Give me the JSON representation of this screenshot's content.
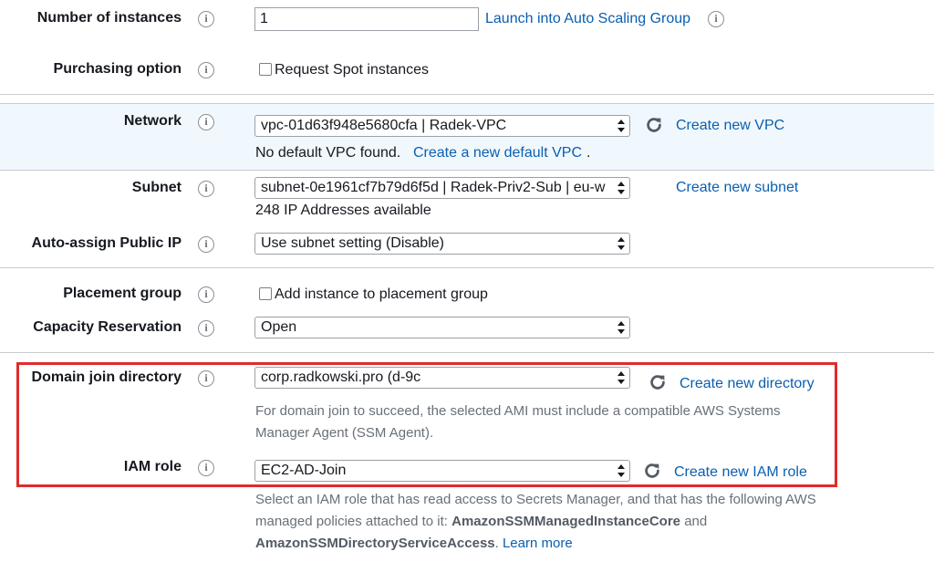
{
  "instances": {
    "label": "Number of instances",
    "value": "1",
    "asg_link": "Launch into Auto Scaling Group"
  },
  "purchasing": {
    "label": "Purchasing option",
    "checkbox_label": "Request Spot instances"
  },
  "network": {
    "label": "Network",
    "value": "vpc-01d63f948e5680cfa | Radek-VPC",
    "create_link": "Create new VPC",
    "no_default": "No default VPC found.",
    "create_default_link": "Create a new default VPC",
    "period": "."
  },
  "subnet": {
    "label": "Subnet",
    "value": "subnet-0e1961cf7b79d6f5d | Radek-Priv2-Sub | eu-w",
    "create_link": "Create new subnet",
    "available": "248 IP Addresses available"
  },
  "public_ip": {
    "label": "Auto-assign Public IP",
    "value": "Use subnet setting (Disable)"
  },
  "placement": {
    "label": "Placement group",
    "checkbox_label": "Add instance to placement group"
  },
  "capacity": {
    "label": "Capacity Reservation",
    "value": "Open"
  },
  "domain": {
    "label": "Domain join directory",
    "value": "corp.radkowski.pro (d-9c",
    "create_link": "Create new directory",
    "help_line1": "For domain join to succeed, the selected AMI must include a compatible AWS Systems",
    "help_line2": "Manager Agent (SSM Agent)."
  },
  "iam": {
    "label": "IAM role",
    "value": "EC2-AD-Join",
    "create_link": "Create new IAM role",
    "help_line1": "Select an IAM role that has read access to Secrets Manager, and that has the following AWS",
    "help_line2_a": "managed policies attached to it: ",
    "policy1": "AmazonSSMManagedInstanceCore",
    "help_line2_b": " and",
    "policy2": "AmazonSSMDirectoryServiceAccess",
    "period": ".",
    "learn_more": "Learn more"
  },
  "icons": {
    "info": "i",
    "info_icon": "info-icon",
    "refresh_icon": "refresh-icon",
    "select_arrow_icon": "chevron-updown-icon"
  },
  "colors": {
    "link": "#0a5fb0",
    "highlight_band": "#f1f8fd",
    "red_box": "#e02b2b"
  }
}
